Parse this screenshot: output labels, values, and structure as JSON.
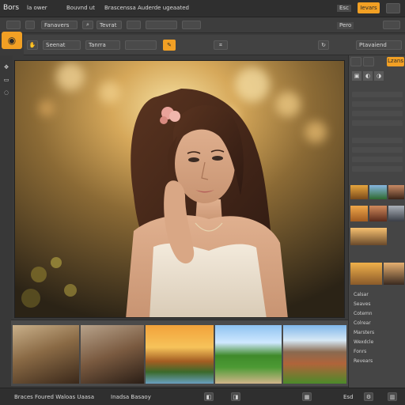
{
  "menubar": {
    "items": [
      "Bors",
      "la ower",
      "Bouvnd ut",
      "Brascenssa",
      "Auderde ugeaated"
    ],
    "right_label": "Esc",
    "right_button": "Ievars"
  },
  "toolbar": {
    "select_a": "Fanavers",
    "select_b": "Tevrat",
    "right_label": "Pero"
  },
  "optionsbar": {
    "field_a": "Seenat",
    "field_b": "Tanrra",
    "right_field": "Ptavaiend"
  },
  "right_panel": {
    "tab_active": "Lzans",
    "section_labels": [
      "Calsar",
      "Seaves",
      "Cotemn",
      "Colrear",
      "Marsters",
      "Wexdcle",
      "Fonrs",
      "Revears"
    ]
  },
  "statusbar": {
    "left_text": "Braces Foured Waloas Uaasa",
    "center_text": "Inadsa Basaoy",
    "right_text": "Esd"
  },
  "colors": {
    "accent": "#f2a024",
    "background": "#3a3a3a",
    "panel": "#454545"
  },
  "icons": {
    "logo": "app-logo-icon",
    "zoom": "zoom-icon",
    "hand": "hand-icon",
    "brush": "brush-icon",
    "crop": "crop-icon",
    "rotate": "rotate-icon",
    "settings": "gear-icon"
  }
}
